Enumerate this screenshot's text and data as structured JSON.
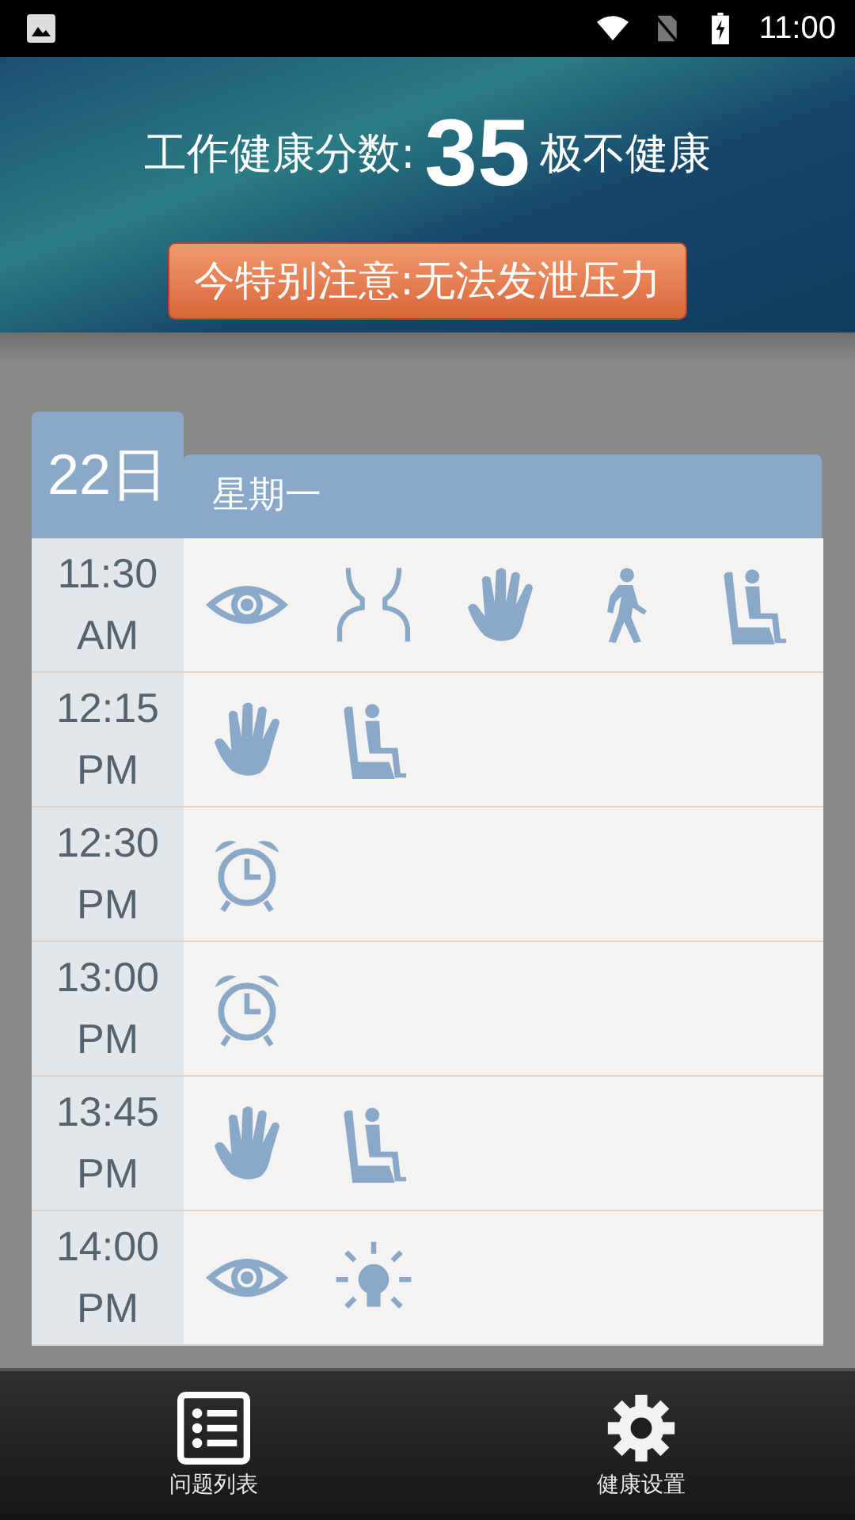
{
  "status_bar": {
    "time": "11:00"
  },
  "header": {
    "label": "工作健康分数:",
    "score": "35",
    "rating": "极不健康",
    "alert": "今特别注意:无法发泄压力"
  },
  "day": {
    "date": "22日",
    "weekday": "星期一"
  },
  "schedule": [
    {
      "time": "11:30",
      "period": "AM",
      "icons": [
        {
          "kind": "eye"
        },
        {
          "kind": "neck"
        },
        {
          "kind": "hand"
        },
        {
          "kind": "walk"
        },
        {
          "kind": "sit"
        }
      ]
    },
    {
      "time": "12:15",
      "period": "PM",
      "icons": [
        {
          "kind": "hand"
        },
        {
          "kind": "sit"
        }
      ]
    },
    {
      "time": "12:30",
      "period": "PM",
      "icons": [
        {
          "kind": "alarm"
        }
      ]
    },
    {
      "time": "13:00",
      "period": "PM",
      "icons": [
        {
          "kind": "alarm"
        }
      ]
    },
    {
      "time": "13:45",
      "period": "PM",
      "icons": [
        {
          "kind": "hand"
        },
        {
          "kind": "sit"
        }
      ]
    },
    {
      "time": "14:00",
      "period": "PM",
      "icons": [
        {
          "kind": "eye"
        },
        {
          "kind": "bulb"
        }
      ]
    }
  ],
  "bottom_nav": [
    {
      "label": "问题列表",
      "kind": "list"
    },
    {
      "label": "健康设置",
      "kind": "settings"
    }
  ]
}
